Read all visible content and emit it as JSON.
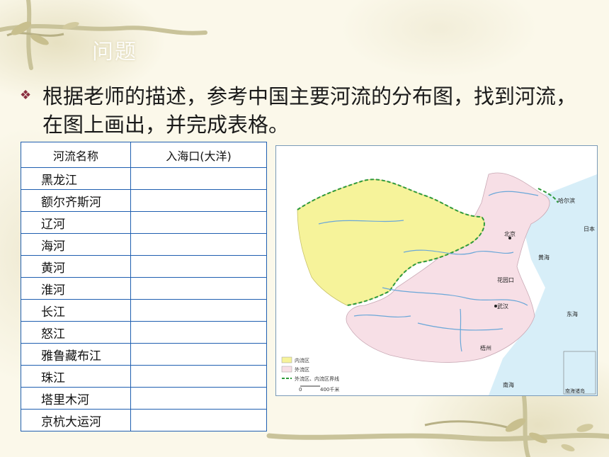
{
  "slide": {
    "title": "问题",
    "instruction": "根据老师的描述，参考中国主要河流的分布图，找到河流，在图上画出，并完成表格。"
  },
  "table": {
    "headers": [
      "河流名称",
      "入海口(大洋)"
    ],
    "rows": [
      {
        "name": "黑龙江",
        "outlet": ""
      },
      {
        "name": "额尔齐斯河",
        "outlet": ""
      },
      {
        "name": "辽河",
        "outlet": ""
      },
      {
        "name": "海河",
        "outlet": ""
      },
      {
        "name": "黄河",
        "outlet": ""
      },
      {
        "name": "淮河",
        "outlet": ""
      },
      {
        "name": "长江",
        "outlet": ""
      },
      {
        "name": "怒江",
        "outlet": ""
      },
      {
        "name": "雅鲁藏布江",
        "outlet": ""
      },
      {
        "name": "珠江",
        "outlet": ""
      },
      {
        "name": "塔里木河",
        "outlet": ""
      },
      {
        "name": "京杭大运河",
        "outlet": ""
      }
    ]
  },
  "map": {
    "cities": {
      "beijing": "北京",
      "wuhan": "武汉",
      "wuzhou": "梧州",
      "harbin": "哈尔滨",
      "huayuankou": "花园口"
    },
    "seas": {
      "yellow_sea": "黄海",
      "east_sea": "东海",
      "south_sea": "南海",
      "japan": "日本"
    },
    "legend": {
      "inland": "内流区",
      "outflow": "外流区",
      "boundary": "外流区、内流区界线",
      "scale": "400千米",
      "scale_zero": "0"
    },
    "inset_label": "南海诸岛",
    "colors": {
      "inland": "#f6f39a",
      "outflow": "#f7dfe6",
      "boundary": "#2e9a3a",
      "water": "#d7eef8",
      "river": "#6aa7d8"
    }
  },
  "colors": {
    "table_border": "#1f5fb0",
    "bullet": "#8a2f3f"
  }
}
